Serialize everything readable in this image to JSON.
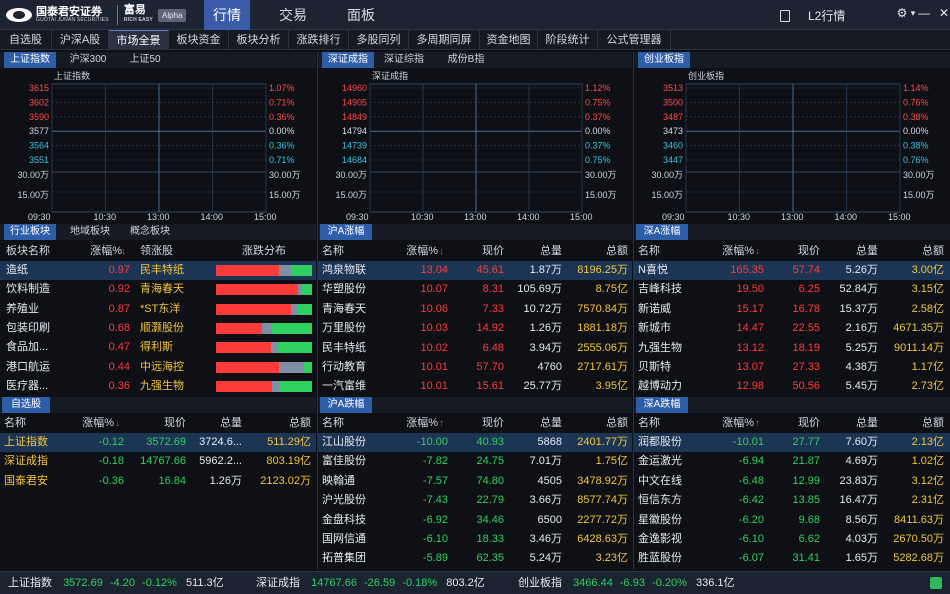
{
  "brand": {
    "name": "国泰君安证券",
    "sub": "GUOTAI JUNAN SECURITIES",
    "product": "富易",
    "product_sub": "RICH EASY",
    "alpha": "Alpha"
  },
  "topnav": [
    "行情",
    "交易",
    "面板"
  ],
  "l2": "L2行情",
  "window_controls": [
    "⚙",
    "▾",
    "—",
    "□",
    "✕"
  ],
  "tabs": [
    "自选股",
    "沪深A股",
    "市场全景",
    "板块资金",
    "板块分析",
    "涨跌排行",
    "多股同列",
    "多周期同屏",
    "资金地图",
    "阶段统计",
    "公式管理器"
  ],
  "charts": [
    {
      "tabs": [
        "上证指数",
        "沪深300",
        "上证50"
      ],
      "title": "上证指数",
      "left_labels": [
        "3615",
        "3602",
        "3590",
        "3577",
        "3564",
        "3551"
      ],
      "right_labels": [
        "1.07%",
        "0.71%",
        "0.36%",
        "0.00%",
        "0.36%",
        "0.71%"
      ],
      "vol_labels": [
        "30.00万",
        "15.00万"
      ],
      "times": [
        "09:30",
        "10:30",
        "13:00",
        "14:00",
        "15:00"
      ]
    },
    {
      "tabs": [
        "深证成指",
        "深证综指",
        "成份B指"
      ],
      "title": "深证成指",
      "left_labels": [
        "14960",
        "14905",
        "14849",
        "14794",
        "14739",
        "14684"
      ],
      "right_labels": [
        "1.12%",
        "0.75%",
        "0.37%",
        "0.00%",
        "0.37%",
        "0.75%"
      ],
      "vol_labels": [
        "30.00万",
        "15.00万"
      ],
      "times": [
        "09:30",
        "10:30",
        "13:00",
        "14:00",
        "15:00"
      ]
    },
    {
      "tabs": [
        "创业板指"
      ],
      "title": "创业板指",
      "left_labels": [
        "3513",
        "3500",
        "3487",
        "3473",
        "3460",
        "3447"
      ],
      "right_labels": [
        "1.14%",
        "0.76%",
        "0.38%",
        "0.00%",
        "0.38%",
        "0.76%"
      ],
      "vol_labels": [
        "30.00万",
        "15.00万"
      ],
      "times": [
        "09:30",
        "10:30",
        "13:00",
        "14:00",
        "15:00"
      ]
    }
  ],
  "sector": {
    "tabs": [
      "行业板块",
      "地域板块",
      "概念板块"
    ],
    "headers": [
      "板块名称",
      "涨幅%",
      "领涨股",
      "涨跌分布"
    ],
    "rows": [
      {
        "name": "造纸",
        "chg": "0.97",
        "lead": "民丰特纸",
        "dist": [
          0.66,
          0.12,
          0.22
        ]
      },
      {
        "name": "饮料制造",
        "chg": "0.92",
        "lead": "青海春天",
        "dist": [
          0.85,
          0.05,
          0.1
        ]
      },
      {
        "name": "养殖业",
        "chg": "0.87",
        "lead": "*ST东洋",
        "dist": [
          0.78,
          0.07,
          0.15
        ]
      },
      {
        "name": "包装印刷",
        "chg": "0.68",
        "lead": "顺灏股份",
        "dist": [
          0.48,
          0.1,
          0.42
        ]
      },
      {
        "name": "食品加...",
        "chg": "0.47",
        "lead": "得利斯",
        "dist": [
          0.57,
          0.08,
          0.35
        ]
      },
      {
        "name": "港口航运",
        "chg": "0.44",
        "lead": "中远海控",
        "dist": [
          0.66,
          0.26,
          0.08
        ]
      },
      {
        "name": "医疗器...",
        "chg": "0.36",
        "lead": "九强生物",
        "dist": [
          0.58,
          0.08,
          0.34
        ]
      }
    ]
  },
  "hu_up": {
    "title": "沪A涨幅",
    "headers": [
      "名称",
      "涨幅%",
      "现价",
      "总量",
      "总额"
    ],
    "rows": [
      [
        "鸿泉物联",
        "13.04",
        "45.61",
        "1.87万",
        "8196.25万"
      ],
      [
        "华塑股份",
        "10.07",
        "8.31",
        "105.69万",
        "8.75亿"
      ],
      [
        "青海春天",
        "10.06",
        "7.33",
        "10.72万",
        "7570.84万"
      ],
      [
        "万里股份",
        "10.03",
        "14.92",
        "1.26万",
        "1881.18万"
      ],
      [
        "民丰特纸",
        "10.02",
        "6.48",
        "3.94万",
        "2555.06万"
      ],
      [
        "行动教育",
        "10.01",
        "57.70",
        "4760",
        "2717.61万"
      ],
      [
        "一汽富维",
        "10.01",
        "15.61",
        "25.77万",
        "3.95亿"
      ]
    ]
  },
  "shen_up": {
    "title": "深A涨幅",
    "headers": [
      "名称",
      "涨幅%",
      "现价",
      "总量",
      "总额"
    ],
    "rows": [
      [
        "N喜悦",
        "165.35",
        "57.74",
        "5.26万",
        "3.00亿"
      ],
      [
        "吉峰科技",
        "19.50",
        "6.25",
        "52.84万",
        "3.15亿"
      ],
      [
        "新诺威",
        "15.17",
        "16.78",
        "15.37万",
        "2.58亿"
      ],
      [
        "新城市",
        "14.47",
        "22.55",
        "2.16万",
        "4671.35万"
      ],
      [
        "九强生物",
        "13.12",
        "18.19",
        "5.25万",
        "9011.14万"
      ],
      [
        "贝斯特",
        "13.07",
        "27.33",
        "4.38万",
        "1.17亿"
      ],
      [
        "越博动力",
        "12.98",
        "50.56",
        "5.45万",
        "2.73亿"
      ]
    ]
  },
  "watch": {
    "title": "自选股",
    "headers": [
      "名称",
      "涨幅%",
      "现价",
      "总量",
      "总额"
    ],
    "rows": [
      [
        "上证指数",
        "-0.12",
        "3572.69",
        "3724.6...",
        "511.29亿"
      ],
      [
        "深证成指",
        "-0.18",
        "14767.66",
        "5962.2...",
        "803.19亿"
      ],
      [
        "国泰君安",
        "-0.36",
        "16.84",
        "1.26万",
        "2123.02万"
      ]
    ]
  },
  "hu_down": {
    "title": "沪A跌幅",
    "headers": [
      "名称",
      "涨幅%",
      "现价",
      "总量",
      "总额"
    ],
    "rows": [
      [
        "江山股份",
        "-10.00",
        "40.93",
        "5868",
        "2401.77万"
      ],
      [
        "富佳股份",
        "-7.82",
        "24.75",
        "7.01万",
        "1.75亿"
      ],
      [
        "映翰通",
        "-7.57",
        "74.80",
        "4505",
        "3478.92万"
      ],
      [
        "沪光股份",
        "-7.43",
        "22.79",
        "3.66万",
        "8577.74万"
      ],
      [
        "金盘科技",
        "-6.92",
        "34.46",
        "6500",
        "2277.72万"
      ],
      [
        "国网信通",
        "-6.10",
        "18.33",
        "3.46万",
        "6428.63万"
      ],
      [
        "拓普集团",
        "-5.89",
        "62.35",
        "5.24万",
        "3.23亿"
      ]
    ]
  },
  "shen_down": {
    "title": "深A跌幅",
    "headers": [
      "名称",
      "涨幅%",
      "现价",
      "总量",
      "总额"
    ],
    "rows": [
      [
        "润都股份",
        "-10.01",
        "27.77",
        "7.60万",
        "2.13亿"
      ],
      [
        "金运激光",
        "-6.94",
        "21.87",
        "4.69万",
        "1.02亿"
      ],
      [
        "中文在线",
        "-6.48",
        "12.99",
        "23.83万",
        "3.12亿"
      ],
      [
        "恒信东方",
        "-6.42",
        "13.85",
        "16.47万",
        "2.31亿"
      ],
      [
        "星徽股份",
        "-6.20",
        "9.68",
        "8.56万",
        "8411.63万"
      ],
      [
        "金逸影视",
        "-6.10",
        "6.62",
        "4.03万",
        "2670.50万"
      ],
      [
        "胜蓝股份",
        "-6.07",
        "31.41",
        "1.65万",
        "5282.68万"
      ]
    ]
  },
  "status": [
    {
      "name": "上证指数",
      "price": "3572.69",
      "chg": "-4.20",
      "pct": "-0.12%",
      "amt": "511.3亿"
    },
    {
      "name": "深证成指",
      "price": "14767.66",
      "chg": "-26.59",
      "pct": "-0.18%",
      "amt": "803.2亿"
    },
    {
      "name": "创业板指",
      "price": "3466.44",
      "chg": "-6.93",
      "pct": "-0.20%",
      "amt": "336.1亿"
    }
  ],
  "colors": {
    "up": "#ff3b3b",
    "down": "#2ed15f",
    "flat": "#7f8fa6",
    "accent": "#2f5ea8"
  }
}
